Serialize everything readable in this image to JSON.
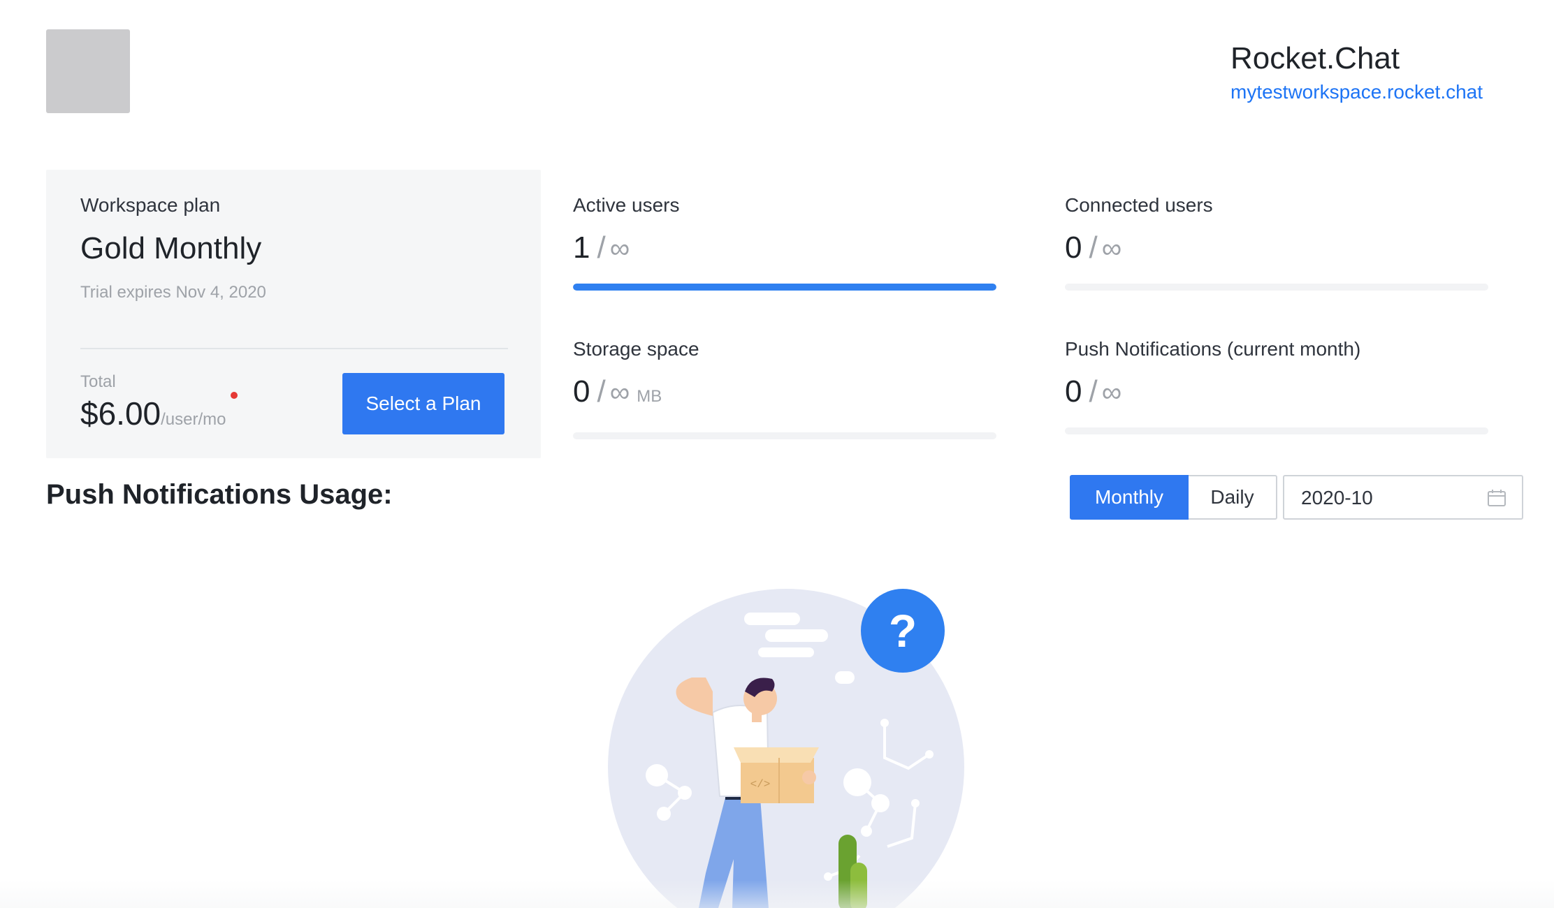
{
  "header": {
    "org_name": "Rocket.Chat",
    "workspace_url": "mytestworkspace.rocket.chat"
  },
  "plan": {
    "label": "Workspace plan",
    "name": "Gold Monthly",
    "trial_text": "Trial expires Nov 4, 2020",
    "total_label": "Total",
    "price": "$6.00",
    "price_unit": "/user/mo",
    "select_button": "Select a Plan",
    "alert_dot_color": "#e53935"
  },
  "stats": {
    "active_users": {
      "label": "Active users",
      "value": "1",
      "separator": "/",
      "limit": "∞",
      "fill_fraction": 1.0
    },
    "connected_users": {
      "label": "Connected users",
      "value": "0",
      "separator": "/",
      "limit": "∞",
      "fill_fraction": 0
    },
    "storage_space": {
      "label": "Storage space",
      "value": "0",
      "separator": "/",
      "limit": "∞",
      "unit": "MB",
      "fill_fraction": 0
    },
    "push_notifications": {
      "label": "Push Notifications (current month)",
      "value": "0",
      "separator": "/",
      "limit": "∞",
      "fill_fraction": 0
    }
  },
  "usage": {
    "title": "Push Notifications Usage:",
    "period_options": [
      "Monthly",
      "Daily"
    ],
    "selected_period": "Monthly",
    "date_value": "2020-10",
    "date_icon": "calendar-icon"
  },
  "empty_state": {
    "icon": "question-mark-icon",
    "question_mark": "?",
    "box_code_glyph": "</>"
  },
  "colors": {
    "accent": "#2f78f0",
    "link": "#1d74f5",
    "progress_fill": "#2f80f0",
    "card_bg": "#f5f6f7"
  }
}
